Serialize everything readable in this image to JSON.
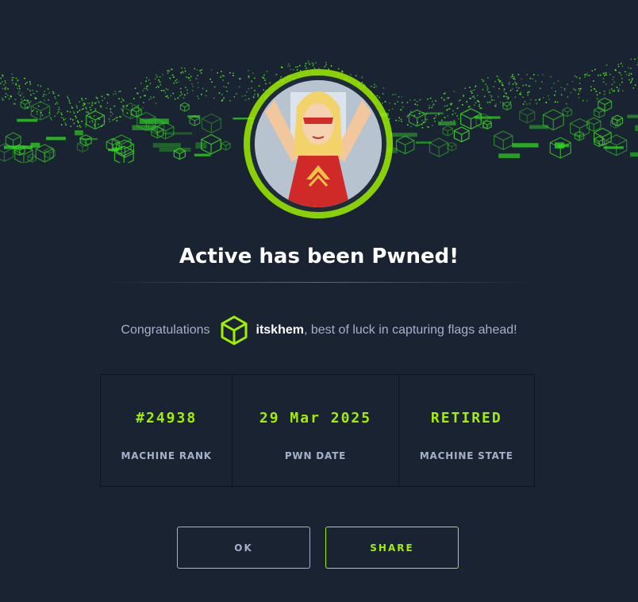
{
  "title": "Active has been Pwned!",
  "congrats": {
    "prefix": "Congratulations",
    "username": "itskhem",
    "suffix": ", best of luck in capturing flags ahead!"
  },
  "stats": [
    {
      "value": "#24938",
      "label": "MACHINE RANK"
    },
    {
      "value": "29 Mar 2025",
      "label": "PWN DATE"
    },
    {
      "value": "RETIRED",
      "label": "MACHINE STATE"
    }
  ],
  "buttons": {
    "ok": "OK",
    "share": "SHARE"
  },
  "icons": {
    "user_badge": "hexagon-cube-icon",
    "avatar": "machine-avatar"
  },
  "colors": {
    "background": "#1a2332",
    "accent": "#9fef00",
    "text_muted": "#a4b1cd",
    "text_primary": "#ffffff"
  }
}
